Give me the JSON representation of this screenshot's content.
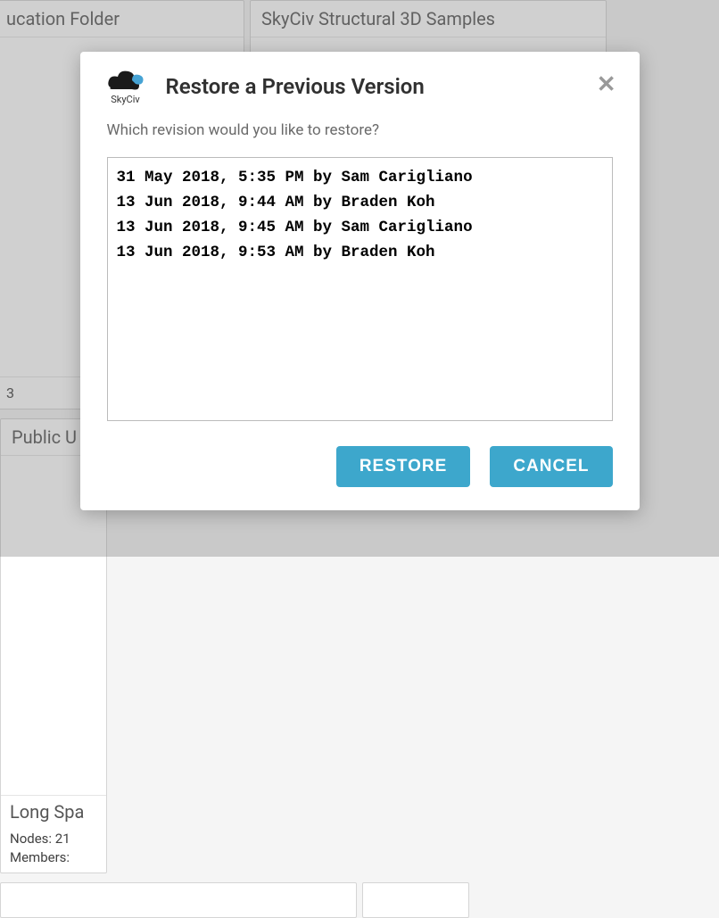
{
  "background": {
    "cards": [
      {
        "title": "ucation Folder",
        "footerNum": "3"
      },
      {
        "title": "SkyCiv Structural 3D Samples"
      },
      {
        "title": "Public U",
        "footerTitle": "Long Spa",
        "meta1": "Nodes: 21",
        "meta2": "Members:"
      }
    ]
  },
  "modal": {
    "logo_text": "SkyCiv",
    "title": "Restore a Previous Version",
    "prompt": "Which revision would you like to restore?",
    "revisions": [
      "31 May 2018, 5:35 PM by Sam Carigliano",
      "13 Jun 2018, 9:44 AM by Braden Koh",
      "13 Jun 2018, 9:45 AM by Sam Carigliano",
      "13 Jun 2018, 9:53 AM by Braden Koh"
    ],
    "buttons": {
      "restore": "RESTORE",
      "cancel": "CANCEL"
    }
  }
}
